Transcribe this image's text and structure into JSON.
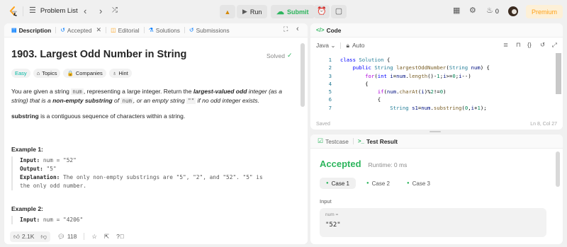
{
  "topbar": {
    "problem_list": "Problem List",
    "run": "Run",
    "submit": "Submit",
    "streak": "0",
    "premium": "Premium"
  },
  "desc_tabs": [
    "Description",
    "Accepted",
    "Editorial",
    "Solutions",
    "Submissions"
  ],
  "problem": {
    "title": "1903. Largest Odd Number in String",
    "status": "Solved",
    "difficulty": "Easy",
    "tags": [
      "Topics",
      "Companies",
      "Hint"
    ],
    "p1_a": "You are given a string ",
    "p1_code1": "num",
    "p1_b": ", representing a large integer. Return the ",
    "p1_bi": "largest-valued odd",
    "p1_c": " integer (as a string) that is a ",
    "p1_bi2": "non-empty substring",
    "p1_d": " of ",
    "p1_code2": "num",
    "p1_e": ", or an empty string ",
    "p1_code3": "\"\"",
    "p1_f": " if no odd integer exists.",
    "p2_b": "substring",
    "p2_rest": " is a contiguous sequence of characters within a string.",
    "ex1_title": "Example 1:",
    "ex1_input_label": "Input:",
    "ex1_input": " num = \"52\"",
    "ex1_output_label": "Output:",
    "ex1_output": " \"5\"",
    "ex1_expl_label": "Explanation:",
    "ex1_expl": " The only non-empty substrings are \"5\", \"2\", and \"52\". \"5\" is",
    "ex1_expl2": "the only odd number.",
    "ex2_title": "Example 2:",
    "ex2_input_label": "Input:",
    "ex2_input": " num = \"4206\""
  },
  "footer": {
    "likes": "2.1K",
    "comments": "118"
  },
  "code_panel": {
    "title": "Code",
    "language": "Java",
    "auto": "Auto",
    "saved": "Saved",
    "cursor": "Ln 8, Col 27"
  },
  "code_lines": [
    "1",
    "2",
    "3",
    "4",
    "5",
    "6",
    "7"
  ],
  "test_tabs": {
    "testcase": "Testcase",
    "result": "Test Result"
  },
  "result": {
    "status": "Accepted",
    "runtime": "Runtime: 0 ms",
    "cases": [
      "Case 1",
      "Case 2",
      "Case 3"
    ],
    "input_label": "Input",
    "var_label": "num =",
    "var_value": "\"52\""
  },
  "colors": {
    "accent_green": "#2db55d",
    "easy": "#00b8a3",
    "premium_bg": "#fdf0d7",
    "premium_text": "#ffa116"
  }
}
